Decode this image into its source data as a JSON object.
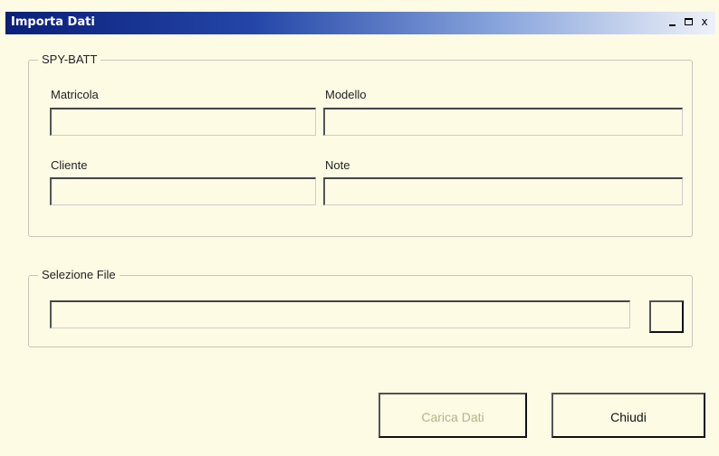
{
  "window": {
    "title": "Importa Dati",
    "controls": {
      "minimize": "_",
      "maximize": "□",
      "close": "x"
    }
  },
  "spy_batt": {
    "legend": "SPY-BATT",
    "fields": {
      "matricola": {
        "label": "Matricola",
        "value": ""
      },
      "modello": {
        "label": "Modello",
        "value": ""
      },
      "cliente": {
        "label": "Cliente",
        "value": ""
      },
      "note": {
        "label": "Note",
        "value": ""
      }
    }
  },
  "selezione_file": {
    "legend": "Selezione File",
    "path_value": "",
    "browse_label": ""
  },
  "buttons": {
    "carica": {
      "label": "Carica Dati",
      "enabled": false
    },
    "chiudi": {
      "label": "Chiudi",
      "enabled": true
    }
  },
  "colors": {
    "background": "#fdfbe4",
    "title_start": "#0a1f7a",
    "title_end": "#eef1f8",
    "disabled_text": "#b6b28a"
  }
}
